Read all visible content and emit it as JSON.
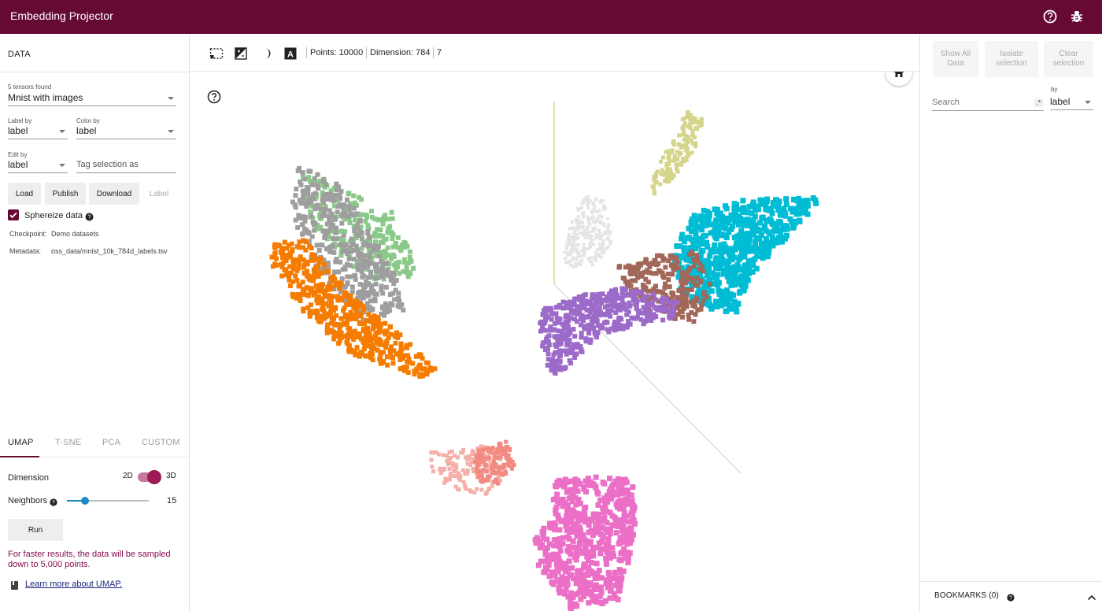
{
  "app": {
    "title": "Embedding Projector"
  },
  "data_panel": {
    "title": "DATA",
    "tensors_found": "5 tensors found",
    "dataset": "Mnist with images",
    "label_by_label": "Label by",
    "label_by_value": "label",
    "color_by_label": "Color by",
    "color_by_value": "label",
    "edit_by_label": "Edit by",
    "edit_by_value": "label",
    "tag_placeholder": "Tag selection as",
    "buttons": {
      "load": "Load",
      "publish": "Publish",
      "download": "Download",
      "label": "Label"
    },
    "sphereize": "Sphereize data",
    "checkpoint_key": "Checkpoint:",
    "checkpoint_value": "Demo datasets",
    "metadata_key": "Metadata:",
    "metadata_value": "oss_data/mnist_10k_784d_labels.tsv"
  },
  "projection": {
    "tabs": [
      "UMAP",
      "T-SNE",
      "PCA",
      "CUSTOM"
    ],
    "active_tab": "UMAP",
    "dimension_label": "Dimension",
    "dim_2d": "2D",
    "dim_3d": "3D",
    "dimension_value": "3D",
    "neighbors_label": "Neighbors",
    "neighbors_value": "15",
    "neighbors_fraction": 0.25,
    "run_label": "Run",
    "note": "For faster results, the data will be sampled down to 5,000 points.",
    "learn_more": "Learn more about UMAP."
  },
  "toolbar": {
    "points": "Points: 10000",
    "dimension": "Dimension: 784",
    "selected": "7"
  },
  "inspector": {
    "show_all": "Show All Data",
    "isolate": "Isolate selection",
    "clear": "Clear selection",
    "search_placeholder": "Search",
    "by_label": "by",
    "by_value": "label",
    "bookmarks": "BOOKMARKS (0)"
  },
  "colors": {
    "brand": "#660a34",
    "cluster_orange": "#f57c00",
    "cluster_grey": "#9e9e9e",
    "cluster_green": "#8bc98b",
    "cluster_cyan": "#00bcd4",
    "cluster_purple": "#9c6ac8",
    "cluster_brown": "#a1685a",
    "cluster_pink": "#ec6fc7",
    "cluster_olive": "#d4d48a",
    "cluster_salmon": "#f28a82"
  },
  "icons": [
    "help-icon",
    "bug-icon",
    "select-box-icon",
    "night-mode-icon",
    "moon-icon",
    "label-a-icon",
    "home-icon",
    "info-icon",
    "book-icon",
    "chevron-up-icon"
  ]
}
